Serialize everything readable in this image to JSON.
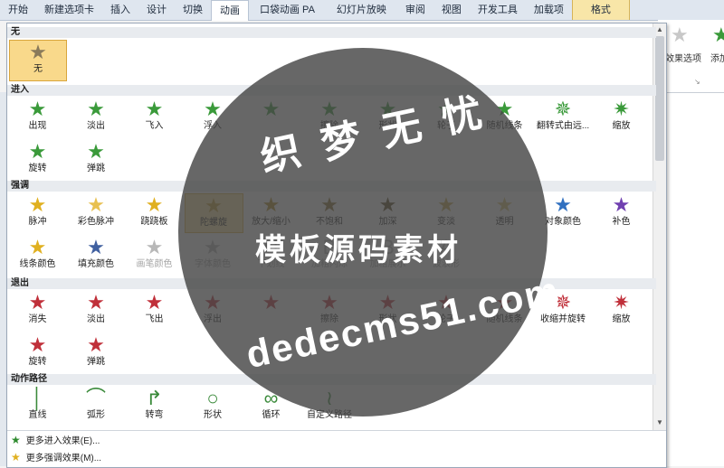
{
  "ribbon": {
    "tabs": [
      "开始",
      "新建选项卡",
      "插入",
      "设计",
      "切换",
      "动画",
      "口袋动画 PA",
      "幻灯片放映",
      "审阅",
      "视图",
      "开发工具",
      "加载项",
      "格式"
    ],
    "active_tab": "动画",
    "effect_options_label": "效果选项",
    "add_label": "添加"
  },
  "sections": {
    "none": "无",
    "entrance": "进入",
    "emphasis": "强调",
    "exit": "退出",
    "motion": "动作路径"
  },
  "none_effect": {
    "label": "无"
  },
  "entrance": [
    "出现",
    "淡出",
    "飞入",
    "浮入",
    "",
    "擦除",
    "形状",
    "轮子",
    "随机线条",
    "翻转式由远...",
    "缩放",
    "旋转",
    "弹跳"
  ],
  "emphasis": [
    "脉冲",
    "彩色脉冲",
    "跷跷板",
    "陀螺旋",
    "放大/缩小",
    "不饱和",
    "加深",
    "变淡",
    "透明",
    "对象颜色",
    "补色",
    "线条颜色",
    "填充颜色",
    "画笔颜色",
    "字体颜色",
    "下划线",
    "加粗闪烁",
    "加粗展示",
    "波浪形"
  ],
  "exit": [
    "消失",
    "淡出",
    "飞出",
    "浮出",
    "",
    "擦除",
    "形状",
    "轮子",
    "随机线条",
    "收缩并旋转",
    "缩放",
    "旋转",
    "弹跳"
  ],
  "motion": [
    "直线",
    "弧形",
    "转弯",
    "形状",
    "循环",
    "自定义路径"
  ],
  "bottom_links": [
    "更多进入效果(E)...",
    "更多强调效果(M)..."
  ],
  "watermark": {
    "line1": "织 梦 无 忧",
    "line2": "模板源码素材",
    "line3": "dedecms51.com"
  },
  "colors": {
    "entrance": "#3a9a3a",
    "emphasis": "#e0b020",
    "exit": "#c0303a",
    "selection": "#fde9a4"
  }
}
